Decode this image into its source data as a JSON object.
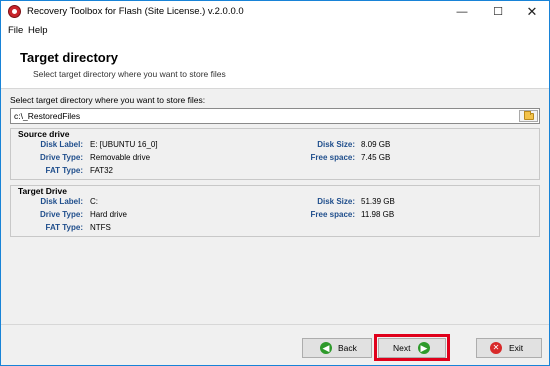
{
  "window": {
    "title": "Recovery Toolbox for Flash (Site License.) v.2.0.0.0",
    "min_glyph": "—",
    "max_glyph": "☐",
    "close_glyph": "✕"
  },
  "menu": {
    "file": "File",
    "help": "Help"
  },
  "header": {
    "title": "Target directory",
    "subtitle": "Select target directory where you want to store files"
  },
  "target_path": {
    "label": "Select target directory where you want to store files:",
    "value": "c:\\_RestoredFiles",
    "browse_icon": "folder-icon"
  },
  "source_drive": {
    "title": "Source drive",
    "disk_label_label": "Disk Label:",
    "disk_label_value": "E: [UBUNTU 16_0]",
    "drive_type_label": "Drive Type:",
    "drive_type_value": "Removable drive",
    "fat_type_label": "FAT Type:",
    "fat_type_value": "FAT32",
    "disk_size_label": "Disk Size:",
    "disk_size_value": "8.09 GB",
    "free_space_label": "Free space:",
    "free_space_value": "7.45 GB"
  },
  "target_drive": {
    "title": "Target Drive",
    "disk_label_label": "Disk Label:",
    "disk_label_value": "C:",
    "drive_type_label": "Drive Type:",
    "drive_type_value": "Hard drive",
    "fat_type_label": "FAT Type:",
    "fat_type_value": "NTFS",
    "disk_size_label": "Disk Size:",
    "disk_size_value": "51.39 GB",
    "free_space_label": "Free space:",
    "free_space_value": "11.98 GB"
  },
  "buttons": {
    "back": "Back",
    "next": "Next",
    "exit": "Exit",
    "back_glyph": "◀",
    "next_glyph": "▶",
    "exit_glyph": "✕"
  },
  "colors": {
    "accent_border": "#1883d7",
    "highlight_red": "#e0001b",
    "label_blue": "#1f4e8c",
    "icon_green": "#2e9a2b",
    "icon_red": "#d82a2a"
  }
}
